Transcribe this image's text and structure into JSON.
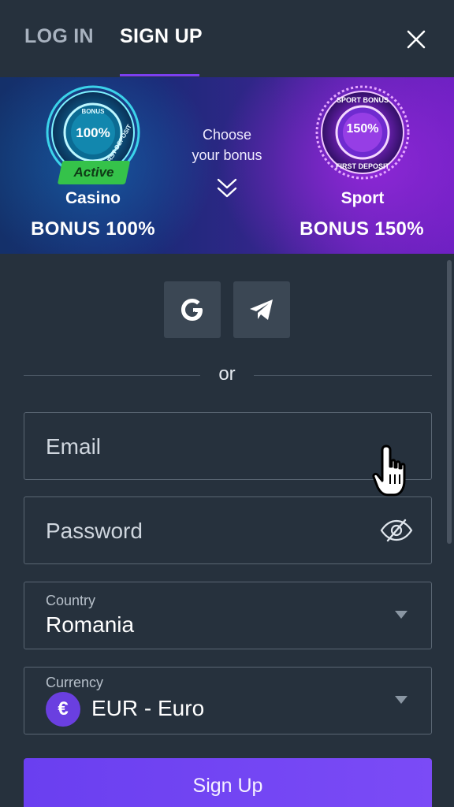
{
  "header": {
    "tabs": [
      {
        "label": "LOG IN",
        "active": false
      },
      {
        "label": "SIGN UP",
        "active": true
      }
    ],
    "close_icon": "close-icon"
  },
  "banner": {
    "choose_text_line1": "Choose",
    "choose_text_line2": "your bonus",
    "casino": {
      "badge_top": "BONUS",
      "badge_percent": "100%",
      "badge_bottom": "FIRST DEPOSIT",
      "status": "Active",
      "name": "Casino",
      "bonus": "BONUS 100%"
    },
    "sport": {
      "badge_top": "SPORT BONUS",
      "badge_percent": "150%",
      "badge_bottom": "FIRST DEPOSIT",
      "name": "Sport",
      "bonus": "BONUS 150%"
    }
  },
  "social": {
    "buttons": [
      "google-icon",
      "telegram-icon"
    ]
  },
  "divider_text": "or",
  "form": {
    "email": {
      "placeholder": "Email",
      "value": ""
    },
    "password": {
      "placeholder": "Password",
      "value": ""
    },
    "country": {
      "caption": "Country",
      "value": "Romania"
    },
    "currency": {
      "caption": "Currency",
      "symbol": "€",
      "value": "EUR - Euro"
    },
    "submit_label": "Sign Up"
  },
  "colors": {
    "background": "#26313d",
    "accent": "#7b3ff2",
    "active_badge": "#35c24a",
    "field_border": "#5a6673"
  }
}
